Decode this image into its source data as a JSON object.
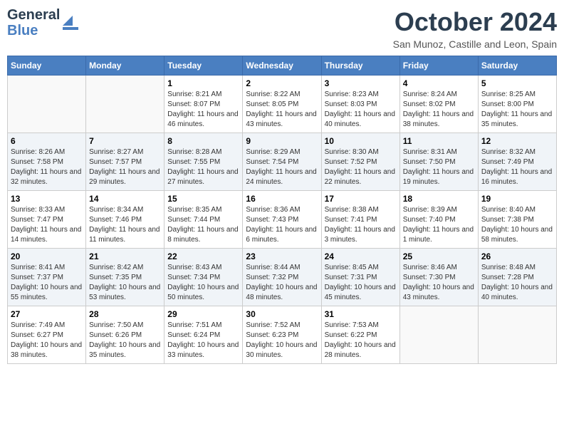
{
  "header": {
    "logo_line1": "General",
    "logo_line2": "Blue",
    "month_title": "October 2024",
    "location": "San Munoz, Castille and Leon, Spain"
  },
  "weekdays": [
    "Sunday",
    "Monday",
    "Tuesday",
    "Wednesday",
    "Thursday",
    "Friday",
    "Saturday"
  ],
  "weeks": [
    [
      {
        "day": "",
        "sunrise": "",
        "sunset": "",
        "daylight": ""
      },
      {
        "day": "",
        "sunrise": "",
        "sunset": "",
        "daylight": ""
      },
      {
        "day": "1",
        "sunrise": "Sunrise: 8:21 AM",
        "sunset": "Sunset: 8:07 PM",
        "daylight": "Daylight: 11 hours and 46 minutes."
      },
      {
        "day": "2",
        "sunrise": "Sunrise: 8:22 AM",
        "sunset": "Sunset: 8:05 PM",
        "daylight": "Daylight: 11 hours and 43 minutes."
      },
      {
        "day": "3",
        "sunrise": "Sunrise: 8:23 AM",
        "sunset": "Sunset: 8:03 PM",
        "daylight": "Daylight: 11 hours and 40 minutes."
      },
      {
        "day": "4",
        "sunrise": "Sunrise: 8:24 AM",
        "sunset": "Sunset: 8:02 PM",
        "daylight": "Daylight: 11 hours and 38 minutes."
      },
      {
        "day": "5",
        "sunrise": "Sunrise: 8:25 AM",
        "sunset": "Sunset: 8:00 PM",
        "daylight": "Daylight: 11 hours and 35 minutes."
      }
    ],
    [
      {
        "day": "6",
        "sunrise": "Sunrise: 8:26 AM",
        "sunset": "Sunset: 7:58 PM",
        "daylight": "Daylight: 11 hours and 32 minutes."
      },
      {
        "day": "7",
        "sunrise": "Sunrise: 8:27 AM",
        "sunset": "Sunset: 7:57 PM",
        "daylight": "Daylight: 11 hours and 29 minutes."
      },
      {
        "day": "8",
        "sunrise": "Sunrise: 8:28 AM",
        "sunset": "Sunset: 7:55 PM",
        "daylight": "Daylight: 11 hours and 27 minutes."
      },
      {
        "day": "9",
        "sunrise": "Sunrise: 8:29 AM",
        "sunset": "Sunset: 7:54 PM",
        "daylight": "Daylight: 11 hours and 24 minutes."
      },
      {
        "day": "10",
        "sunrise": "Sunrise: 8:30 AM",
        "sunset": "Sunset: 7:52 PM",
        "daylight": "Daylight: 11 hours and 22 minutes."
      },
      {
        "day": "11",
        "sunrise": "Sunrise: 8:31 AM",
        "sunset": "Sunset: 7:50 PM",
        "daylight": "Daylight: 11 hours and 19 minutes."
      },
      {
        "day": "12",
        "sunrise": "Sunrise: 8:32 AM",
        "sunset": "Sunset: 7:49 PM",
        "daylight": "Daylight: 11 hours and 16 minutes."
      }
    ],
    [
      {
        "day": "13",
        "sunrise": "Sunrise: 8:33 AM",
        "sunset": "Sunset: 7:47 PM",
        "daylight": "Daylight: 11 hours and 14 minutes."
      },
      {
        "day": "14",
        "sunrise": "Sunrise: 8:34 AM",
        "sunset": "Sunset: 7:46 PM",
        "daylight": "Daylight: 11 hours and 11 minutes."
      },
      {
        "day": "15",
        "sunrise": "Sunrise: 8:35 AM",
        "sunset": "Sunset: 7:44 PM",
        "daylight": "Daylight: 11 hours and 8 minutes."
      },
      {
        "day": "16",
        "sunrise": "Sunrise: 8:36 AM",
        "sunset": "Sunset: 7:43 PM",
        "daylight": "Daylight: 11 hours and 6 minutes."
      },
      {
        "day": "17",
        "sunrise": "Sunrise: 8:38 AM",
        "sunset": "Sunset: 7:41 PM",
        "daylight": "Daylight: 11 hours and 3 minutes."
      },
      {
        "day": "18",
        "sunrise": "Sunrise: 8:39 AM",
        "sunset": "Sunset: 7:40 PM",
        "daylight": "Daylight: 11 hours and 1 minute."
      },
      {
        "day": "19",
        "sunrise": "Sunrise: 8:40 AM",
        "sunset": "Sunset: 7:38 PM",
        "daylight": "Daylight: 10 hours and 58 minutes."
      }
    ],
    [
      {
        "day": "20",
        "sunrise": "Sunrise: 8:41 AM",
        "sunset": "Sunset: 7:37 PM",
        "daylight": "Daylight: 10 hours and 55 minutes."
      },
      {
        "day": "21",
        "sunrise": "Sunrise: 8:42 AM",
        "sunset": "Sunset: 7:35 PM",
        "daylight": "Daylight: 10 hours and 53 minutes."
      },
      {
        "day": "22",
        "sunrise": "Sunrise: 8:43 AM",
        "sunset": "Sunset: 7:34 PM",
        "daylight": "Daylight: 10 hours and 50 minutes."
      },
      {
        "day": "23",
        "sunrise": "Sunrise: 8:44 AM",
        "sunset": "Sunset: 7:32 PM",
        "daylight": "Daylight: 10 hours and 48 minutes."
      },
      {
        "day": "24",
        "sunrise": "Sunrise: 8:45 AM",
        "sunset": "Sunset: 7:31 PM",
        "daylight": "Daylight: 10 hours and 45 minutes."
      },
      {
        "day": "25",
        "sunrise": "Sunrise: 8:46 AM",
        "sunset": "Sunset: 7:30 PM",
        "daylight": "Daylight: 10 hours and 43 minutes."
      },
      {
        "day": "26",
        "sunrise": "Sunrise: 8:48 AM",
        "sunset": "Sunset: 7:28 PM",
        "daylight": "Daylight: 10 hours and 40 minutes."
      }
    ],
    [
      {
        "day": "27",
        "sunrise": "Sunrise: 7:49 AM",
        "sunset": "Sunset: 6:27 PM",
        "daylight": "Daylight: 10 hours and 38 minutes."
      },
      {
        "day": "28",
        "sunrise": "Sunrise: 7:50 AM",
        "sunset": "Sunset: 6:26 PM",
        "daylight": "Daylight: 10 hours and 35 minutes."
      },
      {
        "day": "29",
        "sunrise": "Sunrise: 7:51 AM",
        "sunset": "Sunset: 6:24 PM",
        "daylight": "Daylight: 10 hours and 33 minutes."
      },
      {
        "day": "30",
        "sunrise": "Sunrise: 7:52 AM",
        "sunset": "Sunset: 6:23 PM",
        "daylight": "Daylight: 10 hours and 30 minutes."
      },
      {
        "day": "31",
        "sunrise": "Sunrise: 7:53 AM",
        "sunset": "Sunset: 6:22 PM",
        "daylight": "Daylight: 10 hours and 28 minutes."
      },
      {
        "day": "",
        "sunrise": "",
        "sunset": "",
        "daylight": ""
      },
      {
        "day": "",
        "sunrise": "",
        "sunset": "",
        "daylight": ""
      }
    ]
  ]
}
